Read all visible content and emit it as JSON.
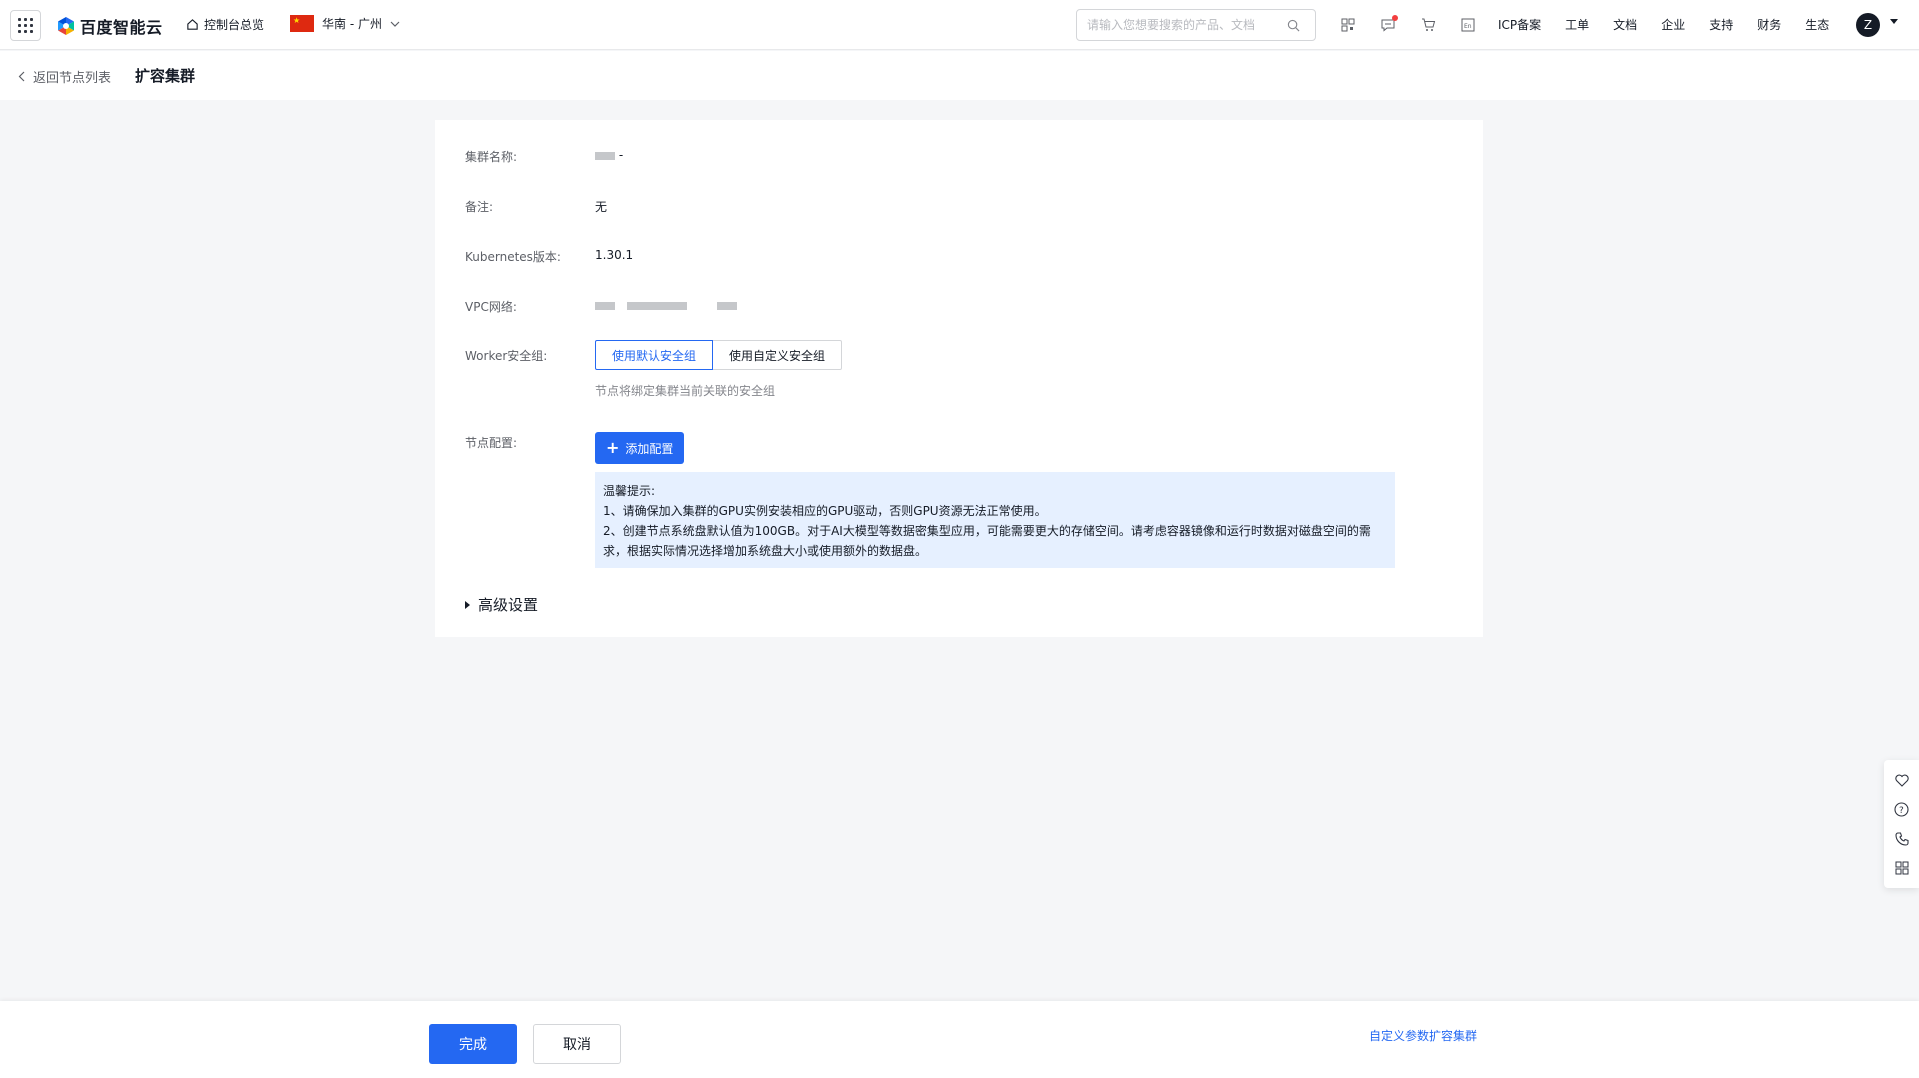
{
  "topbar": {
    "logo_text": "百度智能云",
    "console_label": "控制台总览",
    "region_label": "华南 - 广州",
    "search_placeholder": "请输入您想要搜索的产品、文档",
    "links": [
      "ICP备案",
      "工单",
      "文档",
      "企业",
      "支持",
      "财务",
      "生态"
    ],
    "avatar_letter": "Z"
  },
  "subheader": {
    "back_label": "返回节点列表",
    "title": "扩容集群"
  },
  "form": {
    "cluster_name_label": "集群名称:",
    "cluster_name_suffix": "-",
    "remark_label": "备注:",
    "remark_value": "无",
    "k8s_label": "Kubernetes版本:",
    "k8s_value": "1.30.1",
    "vpc_label": "VPC网络:",
    "worker_sg_label": "Worker安全组:",
    "sg_options": [
      "使用默认安全组",
      "使用自定义安全组"
    ],
    "sg_selected": "使用默认安全组",
    "sg_hint": "节点将绑定集群当前关联的安全组",
    "node_config_label": "节点配置:",
    "add_config_label": "添加配置",
    "notice_title": "温馨提示:",
    "notice_line1": "1、请确保加入集群的GPU实例安装相应的GPU驱动，否则GPU资源无法正常使用。",
    "notice_line2": "2、创建节点系统盘默认值为100GB。对于AI大模型等数据密集型应用，可能需要更大的存储空间。请考虑容器镜像和运行时数据对磁盘空间的需求，根据实际情况选择增加系统盘大小或使用额外的数据盘。",
    "advanced_label": "高级设置"
  },
  "footer": {
    "confirm_label": "完成",
    "cancel_label": "取消",
    "custom_link": "自定义参数扩容集群"
  },
  "colors": {
    "primary": "#2468f2",
    "notice_bg": "#e6f0ff",
    "page_bg": "#f5f6f8"
  }
}
